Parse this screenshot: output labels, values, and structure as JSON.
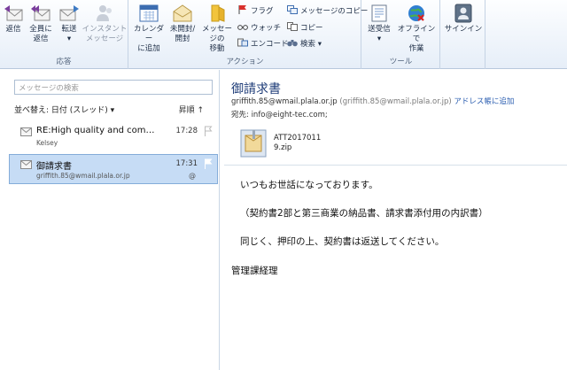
{
  "ribbon": {
    "groups": {
      "reply": "応答",
      "actions": "アクション",
      "tools": "ツール"
    },
    "buttons": {
      "reply": "返信",
      "reply_all": [
        "全員に",
        "返信"
      ],
      "forward": [
        "転送",
        "▾"
      ],
      "instant_message": [
        "インスタント",
        "メッセージ"
      ],
      "add_to_calendar": [
        "カレンダー",
        "に追加"
      ],
      "unread_read": [
        "未開封/",
        "開封"
      ],
      "move_message": [
        "メッセージの",
        "移動"
      ],
      "flag": "フラグ",
      "watch": "ウォッチ",
      "encode": "エンコード",
      "copy_message": "メッセージのコピー",
      "copy": "コピー",
      "search": "検索 ▾",
      "send_receive": [
        "送受信",
        "▾"
      ],
      "work_offline": [
        "オフラインで",
        "作業"
      ],
      "sign_in": "サインイン"
    }
  },
  "list": {
    "search_placeholder": "メッセージの検索",
    "sort_label": "並べ替え: 日付 (スレッド) ▾",
    "sort_dir": "昇順 ↑",
    "messages": [
      {
        "subject": "RE:High quality and com…",
        "from": "Kelsey",
        "time": "17:28",
        "selected": false
      },
      {
        "subject": "御請求書",
        "from": "griffith.85@wmail.plala.or.jp",
        "time": "17:31",
        "selected": true,
        "attachment": "@"
      }
    ]
  },
  "reading": {
    "subject": "御請求書",
    "from_email": "griffith.85@wmail.plala.or.jp",
    "from_paren": "(griffith.85@wmail.plala.or.jp)",
    "add_contact": "アドレス帳に追加",
    "to": "宛先: info@eight-tec.com;",
    "attachment_name": [
      "ATT2017011",
      "9.zip"
    ],
    "body": [
      "いつもお世話になっております。",
      "（契約書2部と第三商業の納品書、請求書添付用の内訳書）",
      "同じく、押印の上、契約書は返送してください。",
      "管理課経理"
    ]
  },
  "colors": {
    "accent": "#1e3c78",
    "selection": "#c6dcf5",
    "ribbon_bg": "#e6eef8"
  }
}
